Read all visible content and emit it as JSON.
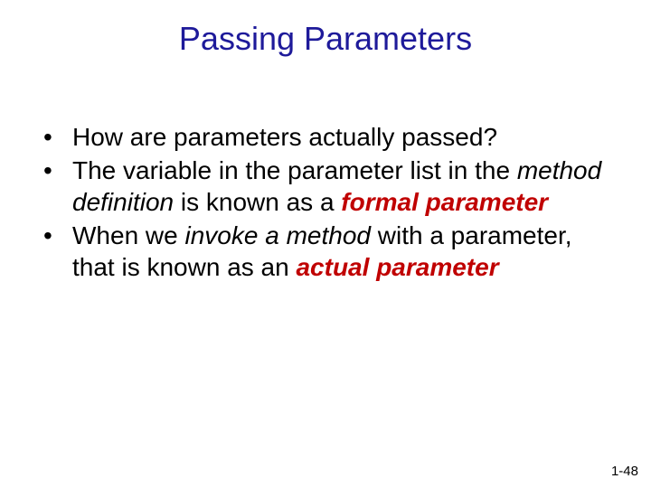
{
  "title": "Passing Parameters",
  "bullets": {
    "b1": "How are parameters actually passed?",
    "b2": {
      "t1": "The variable in the parameter list in the ",
      "t2": "method definition",
      "t3": " is known as a ",
      "t4": "formal parameter"
    },
    "b3": {
      "t1": "When we ",
      "t2": "invoke a method",
      "t3": " with a parameter, that is known as an ",
      "t4": "actual parameter"
    }
  },
  "pagenum": "1-48"
}
